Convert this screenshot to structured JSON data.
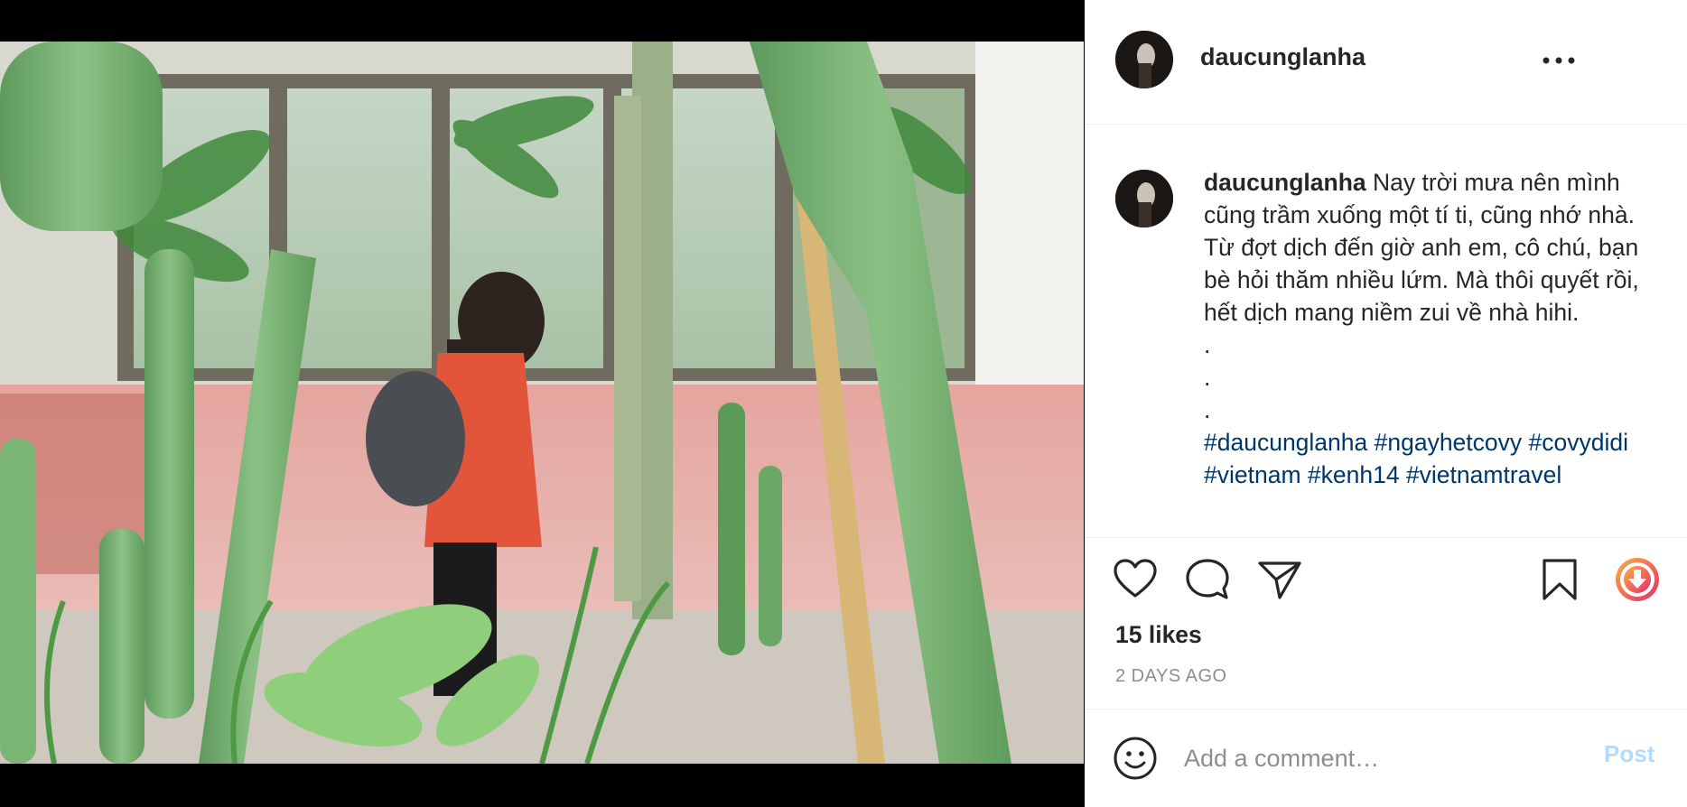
{
  "post": {
    "username": "daucunglanha",
    "caption": {
      "username": "daucunglanha",
      "text": "Nay trời mưa nên mình cũng trầm xuống một tí ti, cũng nhớ nhà. Từ đợt dịch đến giờ anh em, cô chú, bạn bè hỏi thăm nhiều lứm. Mà thôi quyết rồi, hết dịch mang niềm zui về nhà hihi.",
      "dots": [
        ".",
        ".",
        "."
      ],
      "hashtags": "#daucunglanha #ngayhetcovy #covydidi #vietnam #kenh14 #vietnamtravel"
    },
    "likes": "15 likes",
    "timestamp": "2 DAYS AGO"
  },
  "comment_bar": {
    "placeholder": "Add a comment…",
    "post_label": "Post"
  },
  "icons": {
    "more": "more-options-icon",
    "like": "heart-icon",
    "comment": "comment-bubble-icon",
    "share": "paper-plane-icon",
    "save": "bookmark-icon",
    "download": "download-icon",
    "emoji": "smiley-icon"
  },
  "colors": {
    "hashtag": "#00376b",
    "post_button": "#b3dbff",
    "download_gradient_start": "#fcaf45",
    "download_gradient_end": "#e1306c"
  }
}
